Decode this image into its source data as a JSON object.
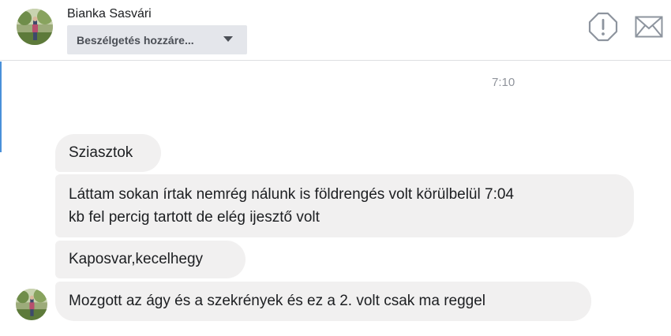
{
  "header": {
    "contact_name": "Bianka Sasvári",
    "conversation_button_label": "Beszélgetés hozzáre...",
    "icons": [
      "alert-icon",
      "mail-icon",
      "chevron-down-icon",
      "avatar"
    ]
  },
  "thread": {
    "timestamp": "7:10",
    "messages": [
      {
        "lines": [
          "Sziasztok"
        ]
      },
      {
        "lines": [
          "Láttam sokan írtak nemrég nálunk is földrengés volt körülbelül 7:04",
          "kb fel percig tartott de elég ijesztő volt"
        ]
      },
      {
        "lines": [
          "Kaposvar,kecelhegy"
        ]
      },
      {
        "lines": [
          "Mozgott az ágy és a szekrények és ez a 2. volt csak ma reggel"
        ]
      }
    ]
  },
  "colors": {
    "bubble_bg": "#f1f0f0",
    "button_bg": "#e4e6eb",
    "icon_gray": "#8d949e",
    "timestamp_gray": "#90949c"
  }
}
